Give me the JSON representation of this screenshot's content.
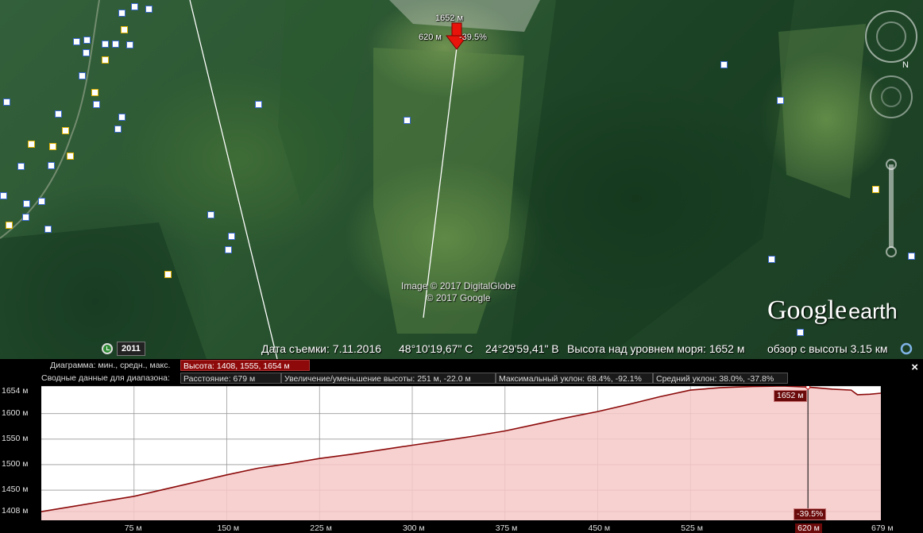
{
  "map": {
    "elevation_point_label": "1652 м",
    "distance_label": "620 м",
    "slope_label": "-39.5%",
    "copyright_line1": "Image © 2017 DigitalGlobe",
    "copyright_line2": "© 2017 Google",
    "logo_google": "Google",
    "logo_earth": "earth",
    "history_year": "2011",
    "status": {
      "capture_date": "Дата съемки: 7.11.2016",
      "lat": "48°10'19,67\" С",
      "lon": "24°29'59,41\" В",
      "elevation": "Высота над уровнем моря:  1652 м",
      "eye_alt": "обзор с высоты   3.15 км"
    }
  },
  "profile": {
    "row1_label": "Диаграмма: мин., средн., макс.",
    "row1_value": "Высота: 1408, 1555, 1654 м",
    "row2_label": "Сводные данные для диапазона:",
    "row2_distance": "Расстояние: 679 м",
    "row2_gain": "Увеличение/уменьшение высоты: 251 м, -22.0 м",
    "row2_max_slope": "Максимальный уклон: 68.4%, -92.1%",
    "row2_avg_slope": "Средний уклон: 38.0%, -37.8%",
    "close_symbol": "×",
    "tooltip_elev": "1652 м",
    "tooltip_slope": "-39.5%",
    "cursor_x_label": "620 м"
  },
  "chart_data": {
    "type": "area",
    "title": "",
    "xlabel": "",
    "ylabel": "",
    "xlim": [
      0,
      679
    ],
    "ylim": [
      1391,
      1654
    ],
    "x_ticks": [
      75,
      150,
      225,
      300,
      375,
      450,
      525,
      620,
      679
    ],
    "x_tick_labels": [
      "75 м",
      "150 м",
      "225 м",
      "300 м",
      "375 м",
      "450 м",
      "525 м",
      "620 м",
      "679 м"
    ],
    "y_ticks": [
      1408,
      1450,
      1500,
      1550,
      1600,
      1654
    ],
    "y_tick_labels": [
      "1408 м",
      "1450 м",
      "1500 м",
      "1550 м",
      "1600 м",
      "1654 м"
    ],
    "x": [
      0,
      25,
      50,
      75,
      100,
      125,
      150,
      175,
      200,
      225,
      250,
      275,
      300,
      325,
      350,
      375,
      400,
      425,
      450,
      475,
      500,
      525,
      550,
      575,
      600,
      620,
      640,
      655,
      660,
      670,
      679
    ],
    "y": [
      1408,
      1418,
      1428,
      1438,
      1452,
      1466,
      1480,
      1493,
      1502,
      1512,
      1520,
      1529,
      1538,
      1547,
      1556,
      1566,
      1579,
      1592,
      1604,
      1618,
      1633,
      1646,
      1651,
      1653,
      1654,
      1652,
      1648,
      1646,
      1637,
      1638,
      1640
    ],
    "cursor_x": 620,
    "grid": true,
    "fill_color": "#f6c8c8",
    "line_color": "#8b0a0a"
  }
}
